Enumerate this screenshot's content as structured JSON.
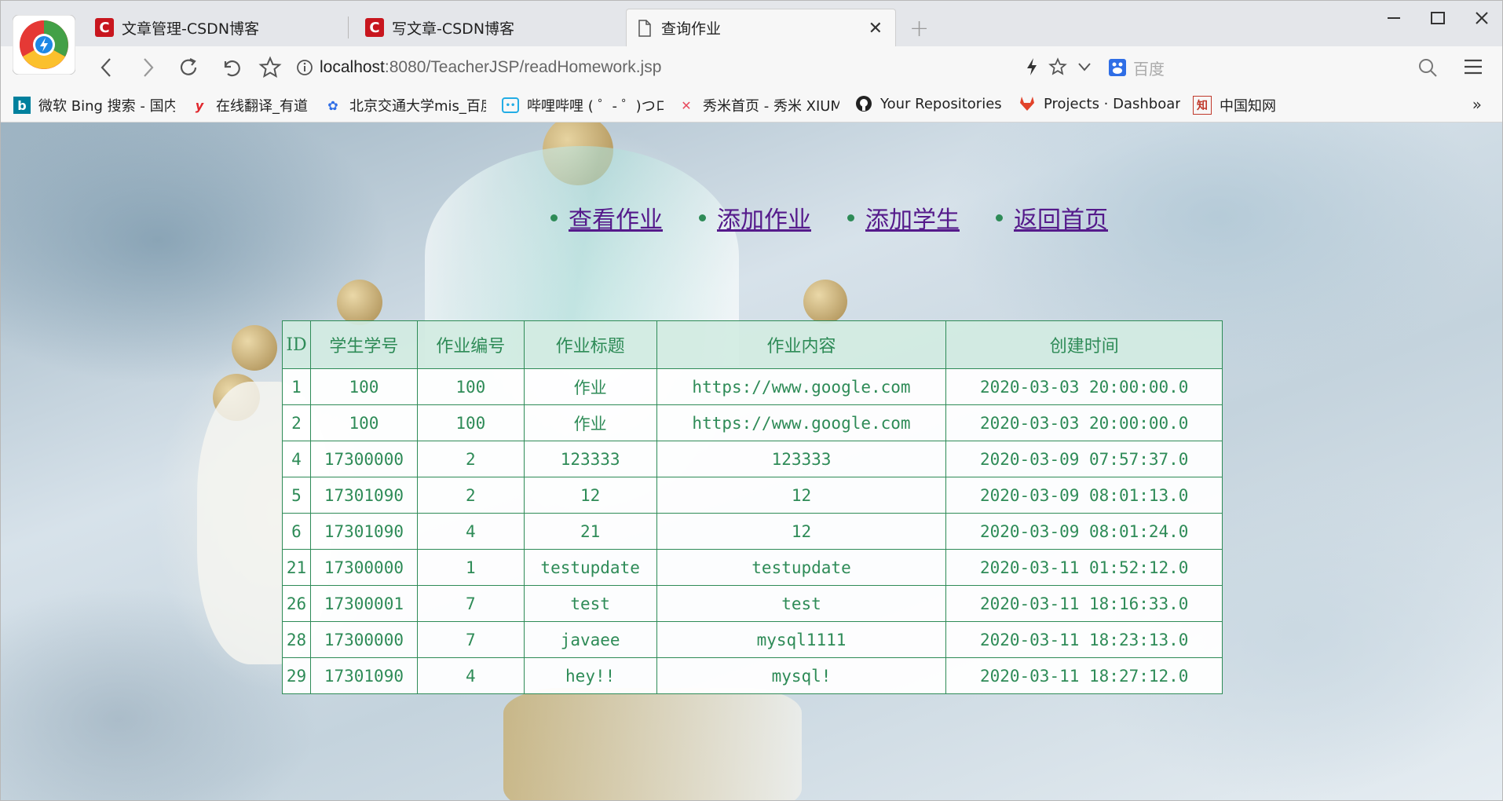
{
  "browser": {
    "tabs": [
      {
        "label": "文章管理-CSDN博客",
        "icon": "csdn-icon"
      },
      {
        "label": "写文章-CSDN博客",
        "icon": "csdn-icon"
      },
      {
        "label": "查询作业",
        "icon": "page-icon",
        "active": true
      }
    ],
    "address": {
      "host": "localhost",
      "rest": ":8080/TeacherJSP/readHomework.jsp"
    },
    "search_placeholder": "百度",
    "bookmarks": [
      {
        "label": "微软 Bing 搜索 - 国内",
        "icon": "bing-icon"
      },
      {
        "label": "在线翻译_有道",
        "icon": "youdao-icon"
      },
      {
        "label": "北京交通大学mis_百度",
        "icon": "baidu-icon"
      },
      {
        "label": "哔哩哔哩 ( ゜- ゜)つロ",
        "icon": "bilibili-icon"
      },
      {
        "label": "秀米首页 - 秀米 XIUMI",
        "icon": "xiumi-icon"
      },
      {
        "label": "Your Repositories",
        "icon": "github-icon"
      },
      {
        "label": "Projects · Dashboard",
        "icon": "gitlab-icon"
      },
      {
        "label": "中国知网",
        "icon": "cnki-icon"
      }
    ],
    "bookmarks_more": "»"
  },
  "nav": [
    "查看作业",
    "添加作业",
    "添加学生",
    "返回首页"
  ],
  "table": {
    "headers": [
      "ID",
      "学生学号",
      "作业编号",
      "作业标题",
      "作业内容",
      "创建时间"
    ],
    "rows": [
      [
        "1",
        "100",
        "100",
        "作业",
        "https://www.google.com",
        "2020-03-03 20:00:00.0"
      ],
      [
        "2",
        "100",
        "100",
        "作业",
        "https://www.google.com",
        "2020-03-03 20:00:00.0"
      ],
      [
        "4",
        "17300000",
        "2",
        "123333",
        "123333",
        "2020-03-09 07:57:37.0"
      ],
      [
        "5",
        "17301090",
        "2",
        "12",
        "12",
        "2020-03-09 08:01:13.0"
      ],
      [
        "6",
        "17301090",
        "4",
        "21",
        "12",
        "2020-03-09 08:01:24.0"
      ],
      [
        "21",
        "17300000",
        "1",
        "testupdate",
        "testupdate",
        "2020-03-11 01:52:12.0"
      ],
      [
        "26",
        "17300001",
        "7",
        "test",
        "test",
        "2020-03-11 18:16:33.0"
      ],
      [
        "28",
        "17300000",
        "7",
        "javaee",
        "mysql1111",
        "2020-03-11 18:23:13.0"
      ],
      [
        "29",
        "17301090",
        "4",
        "hey!!",
        "mysql!",
        "2020-03-11 18:27:12.0"
      ]
    ]
  }
}
